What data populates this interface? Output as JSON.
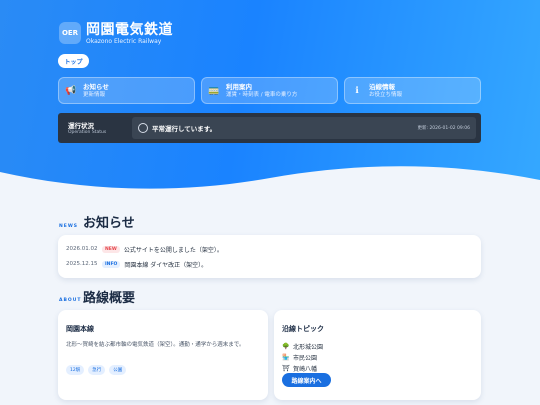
{
  "brand": {
    "badge": "OER",
    "name": "岡園電気鉄道",
    "subtitle": "Okazono Electric Railway"
  },
  "top_button": "トップ",
  "nav": [
    {
      "icon": "megaphone-icon",
      "glyph": "📢",
      "title": "お知らせ",
      "sub": "更新情報"
    },
    {
      "icon": "train-icon",
      "glyph": "🚃",
      "title": "利用案内",
      "sub": "運賃・時刻表 / 電車の乗り方"
    },
    {
      "icon": "info-icon",
      "glyph": "ℹ",
      "title": "沿線情報",
      "sub": "お役立ち情報"
    }
  ],
  "status": {
    "label": "運行状況",
    "label_en": "Operation Status",
    "message": "平常運行しています。",
    "updated": "更新: 2026-01-02 09:06"
  },
  "news": {
    "tag": "NEWS",
    "title": "お知らせ",
    "items": [
      {
        "date": "2026.01.02",
        "badge": "NEW",
        "text": "公式サイトを公開しました（架空）。"
      },
      {
        "date": "2025.12.15",
        "badge": "INFO",
        "text": "岡園本線 ダイヤ改正（架空）。"
      }
    ]
  },
  "about": {
    "tag": "ABOUT",
    "title": "路線概要",
    "line_card": {
      "title": "岡園本線",
      "desc": "北形〜賀崎を結ぶ都市軸の電気鉄道（架空）。通勤・通学から週末まで。",
      "tags": [
        "12駅",
        "急行",
        "公園"
      ]
    },
    "topic_card": {
      "title": "沿線トピック",
      "items": [
        {
          "icon": "tree-icon",
          "glyph": "🌳",
          "text": "北形城公園"
        },
        {
          "icon": "market-icon",
          "glyph": "🏪",
          "text": "市民公園"
        },
        {
          "icon": "shrine-icon",
          "glyph": "⛩",
          "text": "賀崎八幡"
        }
      ],
      "button": "路線案内へ"
    }
  },
  "colors": {
    "accent": "#1a6fe0",
    "hero": "#1a83ff",
    "status_bg": "#2a3442",
    "new_badge": "#e5484d",
    "info_badge": "#1a6fe0"
  }
}
